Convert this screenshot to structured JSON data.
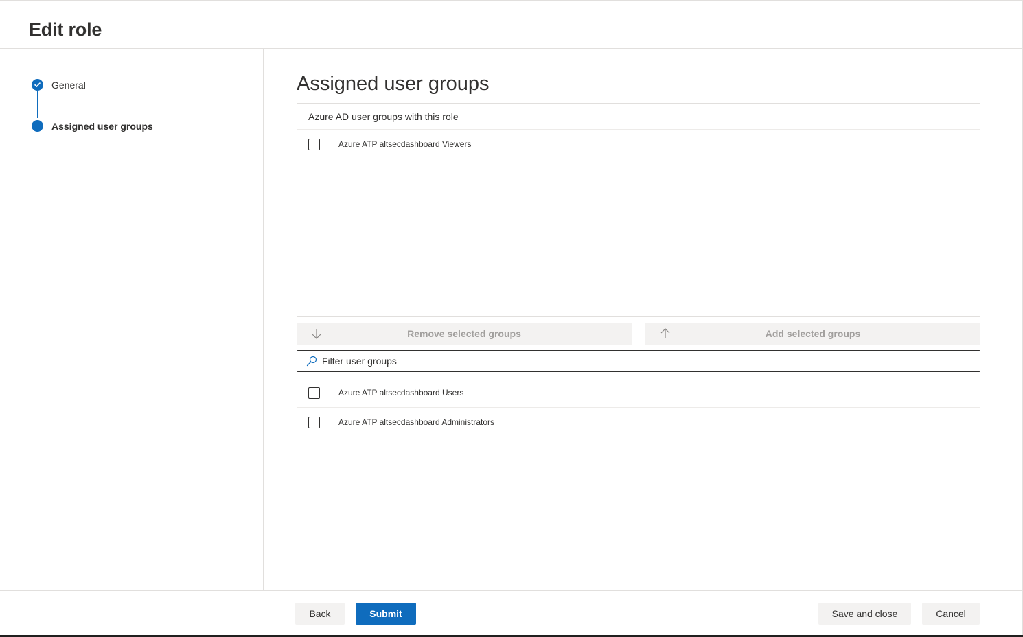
{
  "header": {
    "title": "Edit role"
  },
  "wizard": {
    "steps": [
      {
        "label": "General",
        "state": "completed"
      },
      {
        "label": "Assigned user groups",
        "state": "current"
      }
    ],
    "accent_color": "#0f6cbd"
  },
  "main": {
    "section_title": "Assigned user groups",
    "assigned_list": {
      "header": "Azure AD user groups with this role",
      "items": [
        {
          "label": "Azure ATP altsecdashboard Viewers",
          "checked": false
        }
      ]
    },
    "remove_button": {
      "label": "Remove selected groups",
      "icon": "arrow-down-icon",
      "enabled": false
    },
    "add_button": {
      "label": "Add selected groups",
      "icon": "arrow-up-icon",
      "enabled": false
    },
    "filter": {
      "placeholder": "Filter user groups",
      "value": "",
      "icon": "search-icon"
    },
    "available_list": {
      "items": [
        {
          "label": "Azure ATP altsecdashboard Users",
          "checked": false
        },
        {
          "label": "Azure ATP altsecdashboard Administrators",
          "checked": false
        }
      ]
    }
  },
  "footer": {
    "back_label": "Back",
    "submit_label": "Submit",
    "save_close_label": "Save and close",
    "cancel_label": "Cancel"
  }
}
